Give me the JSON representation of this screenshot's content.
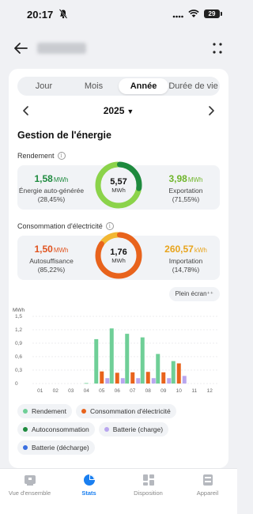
{
  "status_bar": {
    "time": "20:17",
    "battery": "29"
  },
  "tabs": [
    {
      "label": "Jour",
      "active": false
    },
    {
      "label": "Mois",
      "active": false
    },
    {
      "label": "Année",
      "active": true
    },
    {
      "label": "Durée de vie",
      "active": false
    }
  ],
  "year": "2025",
  "section_title": "Gestion de l'énergie",
  "rendement": {
    "title": "Rendement",
    "left": {
      "value": "1,58",
      "unit": "MWh",
      "label": "Énergie auto-générée",
      "pct": "(28,45%)",
      "color": "#1e8a3e"
    },
    "center": {
      "value": "5,57",
      "unit": "MWh",
      "fraction": 0.2845
    },
    "right": {
      "value": "3,98",
      "unit": "MWh",
      "label": "Exportation",
      "pct": "(71,55%)",
      "color": "#7cc42e"
    }
  },
  "consommation": {
    "title": "Consommation d'électricité",
    "left": {
      "value": "1,50",
      "unit": "MWh",
      "label": "Autosuffisance",
      "pct": "(85,22%)",
      "color": "#e0531f"
    },
    "center": {
      "value": "1,76",
      "unit": "MWh",
      "fraction": 0.8522
    },
    "right": {
      "value": "260,57",
      "unit": "kWh",
      "label": "Importation",
      "pct": "(14,78%)",
      "color": "#e8a41c"
    }
  },
  "fullscreen_label": "Plein écran⁺⁺",
  "chart_data": {
    "type": "bar",
    "ylabel": "MWh",
    "ylim": [
      0,
      1.5
    ],
    "yticks": [
      "0",
      "0,3",
      "0,6",
      "0,9",
      "1,2",
      "1,5"
    ],
    "categories": [
      "01",
      "02",
      "03",
      "04",
      "05",
      "06",
      "07",
      "08",
      "09",
      "10",
      "11",
      "12"
    ],
    "series": [
      {
        "name": "Rendement",
        "color": "#6fcf97",
        "values": [
          0,
          0,
          0,
          0.01,
          0.99,
          1.23,
          1.11,
          1.03,
          0.66,
          0.5,
          0,
          0
        ]
      },
      {
        "name": "Consommation d'électricité",
        "color": "#e8631c",
        "values": [
          0,
          0,
          0,
          0,
          0.27,
          0.24,
          0.25,
          0.26,
          0.25,
          0.45,
          0,
          0
        ]
      },
      {
        "name": "Autoconsommation",
        "color": "#1e8a3e",
        "values": [
          0,
          0,
          0,
          0,
          0,
          0,
          0,
          0,
          0,
          0,
          0,
          0
        ]
      },
      {
        "name": "Batterie (charge)",
        "color": "#b9a6ef",
        "values": [
          0,
          0,
          0,
          0,
          0.12,
          0.12,
          0.12,
          0.12,
          0.12,
          0.17,
          0,
          0
        ]
      },
      {
        "name": "Batterie (décharge)",
        "color": "#3a6fe0",
        "values": [
          0,
          0,
          0,
          0,
          0,
          0,
          0,
          0,
          0,
          0,
          0,
          0
        ]
      }
    ]
  },
  "bottom_nav": [
    {
      "label": "Vue d'ensemble",
      "icon": "overview-icon",
      "active": false
    },
    {
      "label": "Stats",
      "icon": "stats-pie-icon",
      "active": true
    },
    {
      "label": "Disposition",
      "icon": "layout-icon",
      "active": false
    },
    {
      "label": "Appareil",
      "icon": "device-icon",
      "active": false
    }
  ]
}
